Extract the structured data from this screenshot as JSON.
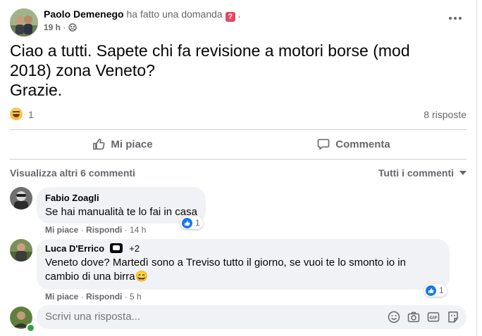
{
  "post": {
    "author": "Paolo Demenego",
    "action": "ha fatto una domanda",
    "badge_symbol": "?",
    "after_badge": ".",
    "time": "19 h",
    "separator": "·",
    "text_line1": "Ciao a tutti. Sapete chi fa revisione a motori borse (mod",
    "text_line2": "2018) zona Veneto?",
    "text_line3": "Grazie.",
    "reaction_count": "1",
    "replies_count": "8 risposte",
    "more_icon": "more-horizontal-icon",
    "privacy_icon": "group-icon"
  },
  "actions": {
    "like_label": "Mi piace",
    "comment_label": "Commenta"
  },
  "comments_bar": {
    "view_more": "Visualizza altri 6 commenti",
    "filter": "Tutti i commenti"
  },
  "comments": [
    {
      "name": "Fabio Zoagli",
      "text": "Se hai manualità te lo fai in casa",
      "like": "Mi piace",
      "reply": "Rispondi",
      "time": "14 h",
      "reaction_count": "1"
    },
    {
      "name": "Luca D'Errico",
      "badge_extra": "+2",
      "text_line1": "Veneto dove? Martedì sono a Treviso tutto il giorno, se vuoi te lo smonto io in",
      "text_line2": "cambio di una birra",
      "emoji": "😄",
      "like": "Mi piace",
      "reply": "Rispondi",
      "time": "5 h",
      "reaction_count": "1"
    }
  ],
  "reply": {
    "placeholder": "Scrivi una risposta..."
  },
  "colors": {
    "accent": "#1877f2",
    "secondary_text": "#65676b",
    "bubble": "#f0f2f5",
    "online": "#31a24c"
  }
}
